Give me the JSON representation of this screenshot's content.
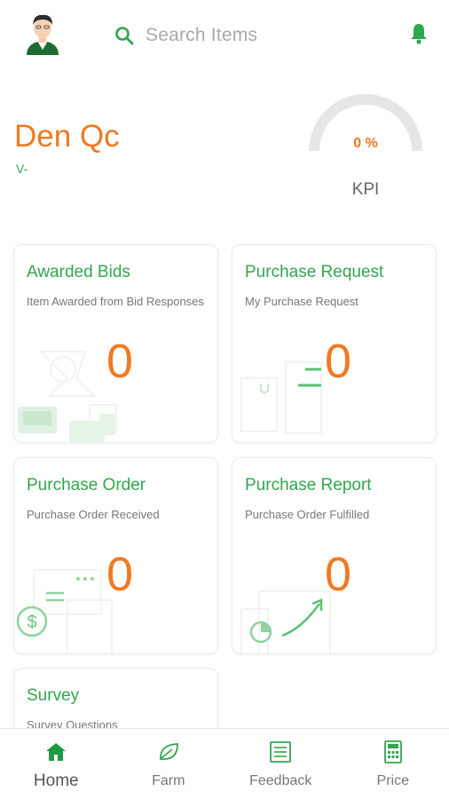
{
  "header": {
    "search_placeholder": "Search Items",
    "avatar_icon": "user-avatar",
    "search_icon": "search-icon",
    "notification_icon": "bell-icon"
  },
  "user": {
    "name": "Den Qc",
    "subtitle": "V-"
  },
  "kpi": {
    "value": "0 %",
    "label": "KPI",
    "fraction": 0
  },
  "cards": [
    {
      "title": "Awarded Bids",
      "subtitle": "Item Awarded from Bid Responses",
      "count": "0"
    },
    {
      "title": "Purchase Request",
      "subtitle": "My Purchase Request",
      "count": "0"
    },
    {
      "title": "Purchase Order",
      "subtitle": "Purchase Order Received",
      "count": "0"
    },
    {
      "title": "Purchase Report",
      "subtitle": "Purchase Order Fulfilled",
      "count": "0"
    },
    {
      "title": "Survey",
      "subtitle": "Survey Questions"
    }
  ],
  "nav": [
    {
      "label": "Home",
      "icon": "home-icon",
      "active": true
    },
    {
      "label": "Farm",
      "icon": "leaf-icon",
      "active": false
    },
    {
      "label": "Feedback",
      "icon": "feedback-list-icon",
      "active": false
    },
    {
      "label": "Price",
      "icon": "calculator-icon",
      "active": false
    }
  ],
  "colors": {
    "accent_green": "#31a64e",
    "accent_orange": "#f07a22",
    "gauge_track": "#e6e6e6"
  }
}
